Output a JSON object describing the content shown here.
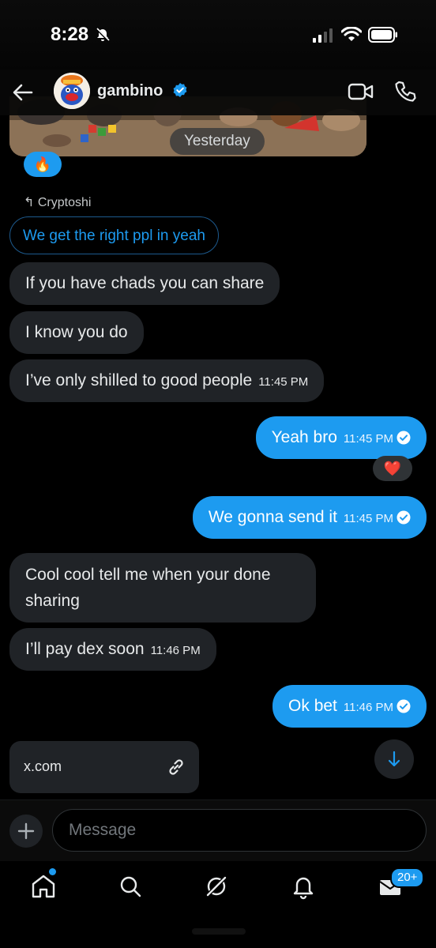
{
  "status_bar": {
    "time": "8:28"
  },
  "header": {
    "contact_name": "gambino"
  },
  "chat": {
    "date_separator": "Yesterday",
    "reaction_fire": "🔥",
    "reply_to_label": "Cryptoshi",
    "reply_quote": "We get the right ppl in yeah",
    "messages": [
      {
        "side": "in",
        "text": "If you have chads you can share",
        "time": ""
      },
      {
        "side": "in",
        "text": "I know you do",
        "time": ""
      },
      {
        "side": "in",
        "text": "I’ve only shilled to good people",
        "time": "11:45 PM"
      },
      {
        "side": "out",
        "text": "Yeah bro",
        "time": "11:45 PM"
      },
      {
        "side": "out",
        "text": "We gonna send it",
        "time": "11:45 PM"
      },
      {
        "side": "in",
        "text": "Cool cool tell me when your done sharing",
        "time": ""
      },
      {
        "side": "in",
        "text": "I’ll pay dex soon",
        "time": "11:46 PM"
      },
      {
        "side": "out",
        "text": "Ok bet",
        "time": "11:46 PM"
      }
    ],
    "reaction_heart": "❤️",
    "link_card_text": "x.com"
  },
  "composer": {
    "placeholder": "Message"
  },
  "nav": {
    "messages_badge": "20+"
  },
  "colors": {
    "accent": "#1d9bf0",
    "incoming_bubble": "#202327",
    "background": "#000000"
  }
}
